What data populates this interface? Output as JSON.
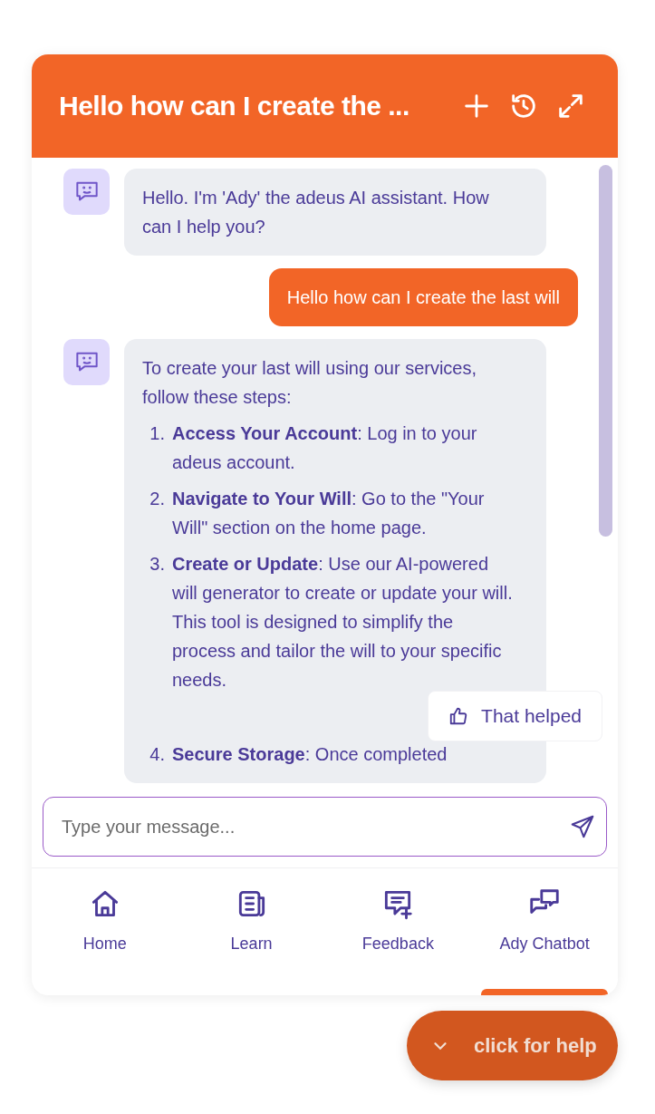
{
  "header": {
    "title": "Hello how can I create the ...",
    "buttons": [
      {
        "kind": "new"
      },
      {
        "kind": "history"
      },
      {
        "kind": "expand"
      }
    ]
  },
  "messages": [
    {
      "kind": "bot",
      "text": "Hello. I'm 'Ady' the adeus AI assistant. How can I help you?"
    },
    {
      "kind": "user",
      "text": "Hello how can I create the last will"
    },
    {
      "kind": "bot",
      "text": "To create your last will using our services, follow these steps:",
      "steps": [
        {
          "number": "1.",
          "text": "**Access Your Account**: Log in to your adeus account."
        },
        {
          "number": "2.",
          "text": "**Navigate to Your Will**: Go to the \"Your Will\" section on the home page."
        },
        {
          "number": "3.",
          "text": "**Create or Update**: Use our AI-powered will generator to create or update your will. This tool is designed to simplify the process and tailor the will to your specific needs."
        },
        {
          "number": "4.",
          "text": "**Secure Storage**: Once completed"
        }
      ]
    }
  ],
  "feedback_button": {
    "label": "That helped"
  },
  "input": {
    "placeholder": "Type your message..."
  },
  "nav": [
    {
      "label": "Home",
      "selected": false
    },
    {
      "label": "Learn",
      "selected": false
    },
    {
      "label": "Feedback",
      "selected": false
    },
    {
      "label": "Ady Chatbot",
      "selected": true
    }
  ],
  "help_button": {
    "label": "click for help"
  }
}
